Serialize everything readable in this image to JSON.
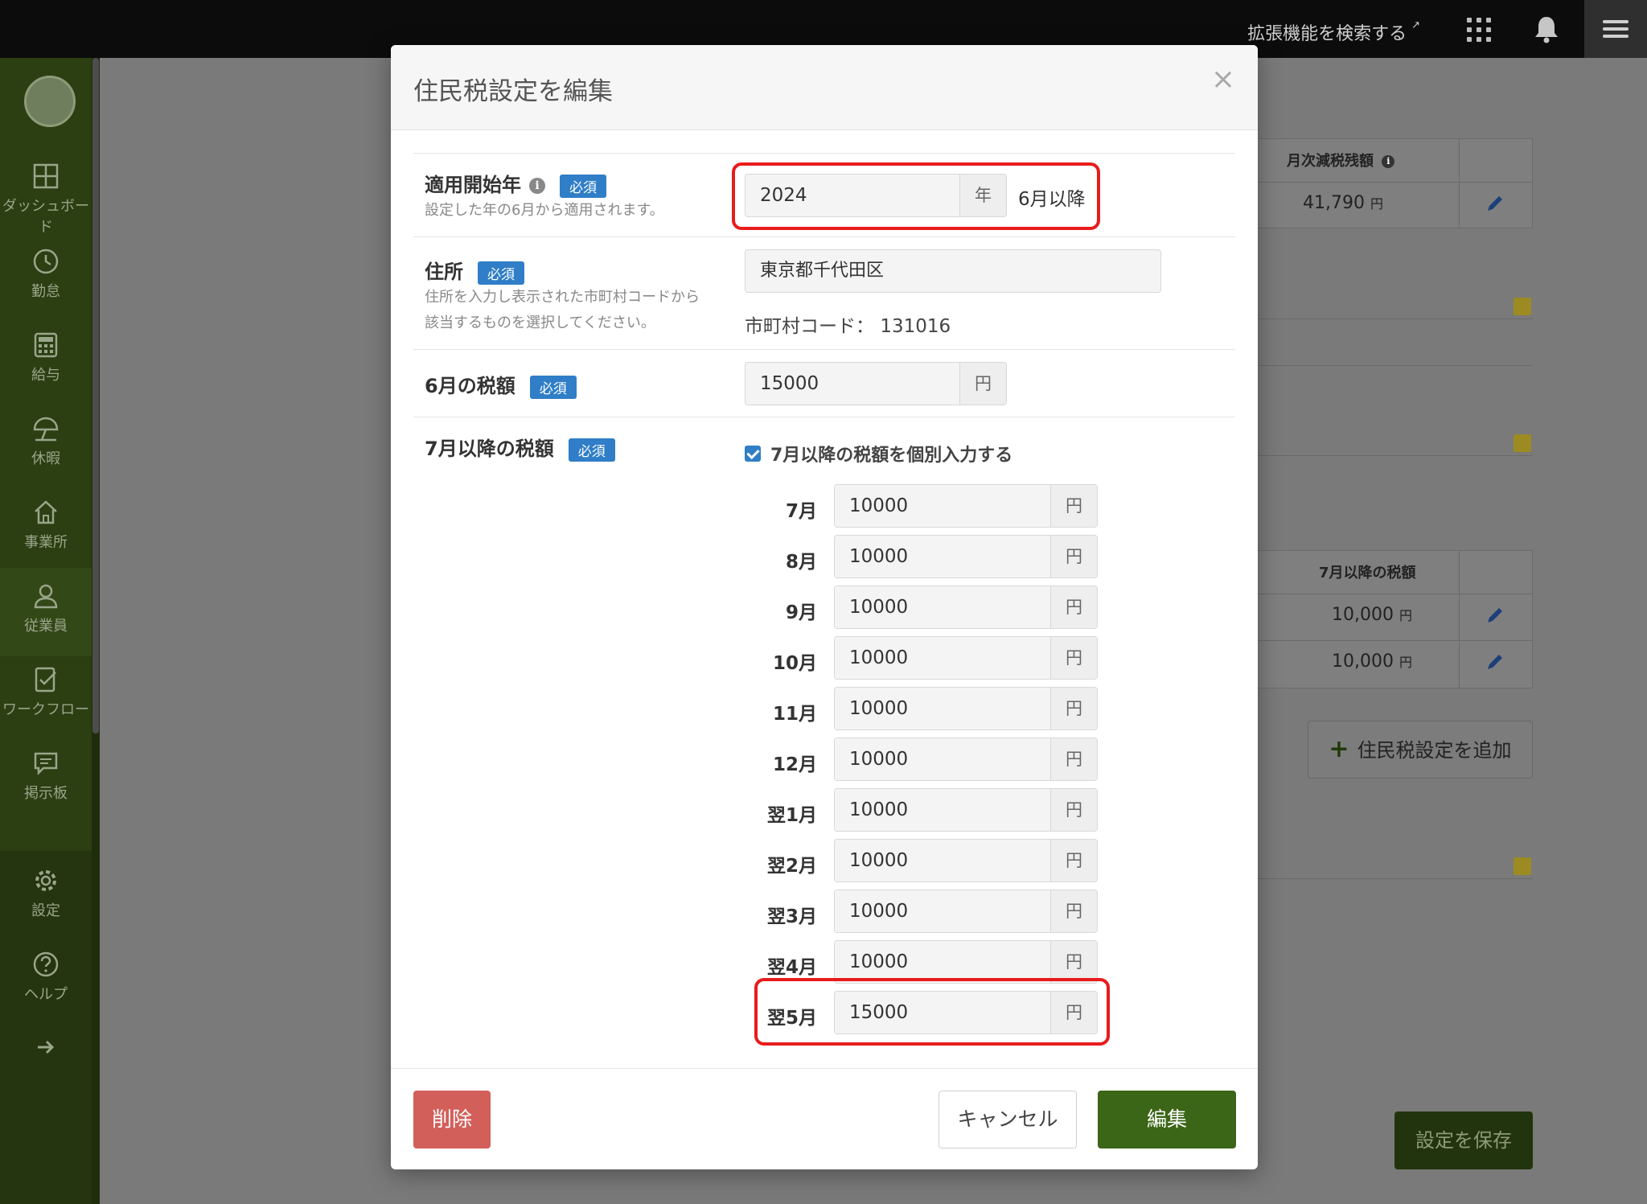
{
  "topbar": {
    "ext_link": "拡張機能を検索する",
    "ext_icon": "↗"
  },
  "sidebar": {
    "items": [
      {
        "label": "ダッシュボード",
        "icon": "dashboard-icon"
      },
      {
        "label": "勤怠",
        "icon": "clock-icon"
      },
      {
        "label": "給与",
        "icon": "calculator-icon"
      },
      {
        "label": "休暇",
        "icon": "umbrella-icon"
      },
      {
        "label": "事業所",
        "icon": "home-icon"
      },
      {
        "label": "従業員",
        "icon": "person-icon",
        "active": true
      },
      {
        "label": "ワークフロー",
        "icon": "checklist-icon"
      },
      {
        "label": "掲示板",
        "icon": "chat-icon"
      },
      {
        "label": "設定",
        "icon": "gear-icon"
      },
      {
        "label": "ヘルプ",
        "icon": "help-icon"
      }
    ]
  },
  "background": {
    "th_monthly": "月次減税残額",
    "td_monthly": "41,790",
    "th_july": "7月以降の税額",
    "td_july_1": "10,000",
    "td_july_2": "10,000",
    "yen": "円",
    "add_button": "住民税設定を追加",
    "add_plus": "+",
    "save_button": "設定を保存"
  },
  "modal": {
    "title": "住民税設定を編集",
    "close": "×",
    "required": "必須",
    "start_year": {
      "label": "適用開始年",
      "help": "設定した年の6月から適用されます。",
      "value": "2024",
      "addon": "年",
      "after": "6月以降"
    },
    "address": {
      "label": "住所",
      "help_line1": "住所を入力し表示された市町村コードから",
      "help_line2": "該当するものを選択してください。",
      "value": "東京都千代田区",
      "code_label": "市町村コード：",
      "code_value": "131016"
    },
    "june_tax": {
      "label": "6月の税額",
      "value": "15000",
      "addon": "円"
    },
    "july_tax": {
      "label": "7月以降の税額",
      "checkbox_label": "7月以降の税額を個別入力する",
      "months": [
        {
          "label": "7月",
          "value": "10000"
        },
        {
          "label": "8月",
          "value": "10000"
        },
        {
          "label": "9月",
          "value": "10000"
        },
        {
          "label": "10月",
          "value": "10000"
        },
        {
          "label": "11月",
          "value": "10000"
        },
        {
          "label": "12月",
          "value": "10000"
        },
        {
          "label": "翌1月",
          "value": "10000"
        },
        {
          "label": "翌2月",
          "value": "10000"
        },
        {
          "label": "翌3月",
          "value": "10000"
        },
        {
          "label": "翌4月",
          "value": "10000"
        },
        {
          "label": "翌5月",
          "value": "15000"
        }
      ],
      "addon": "円"
    },
    "footer": {
      "delete": "削除",
      "cancel": "キャンセル",
      "submit": "編集"
    }
  },
  "colors": {
    "accent_green": "#3b6517",
    "required_blue": "#2f7ec7",
    "delete_red": "#d35f5a",
    "highlight_red": "#e81c1c"
  }
}
